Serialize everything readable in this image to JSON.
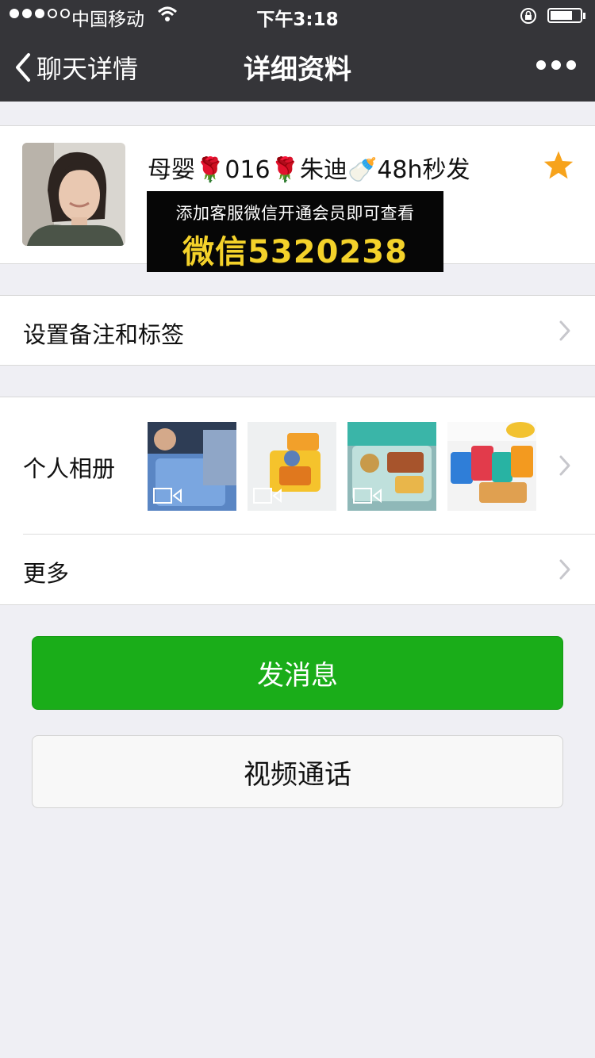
{
  "status_bar": {
    "carrier": "中国移动",
    "time": "下午3:18",
    "signal_bars": 3,
    "signal_total": 5
  },
  "nav": {
    "back_label": "聊天详情",
    "title": "详细资料",
    "more_icon": "ellipsis-icon"
  },
  "profile": {
    "nickname": "母婴🌹016🌹朱迪🍼48h秒发",
    "starred": true,
    "star_color": "#f7a31c"
  },
  "overlay_banner": {
    "line1": "添加客服微信开通会员即可查看",
    "line2": "微信5320238"
  },
  "menu": {
    "remark_label": "设置备注和标签",
    "album_label": "个人相册",
    "more_label": "更多"
  },
  "album_thumbs": [
    {
      "type": "video",
      "icon": "video-icon"
    },
    {
      "type": "video",
      "icon": "video-icon"
    },
    {
      "type": "video",
      "icon": "video-icon"
    },
    {
      "type": "image"
    }
  ],
  "buttons": {
    "send_message": "发消息",
    "video_call": "视频通话"
  },
  "colors": {
    "topbar": "#353539",
    "accent_green": "#1aad19",
    "background": "#efeff4",
    "banner_text": "#f4d22a"
  }
}
